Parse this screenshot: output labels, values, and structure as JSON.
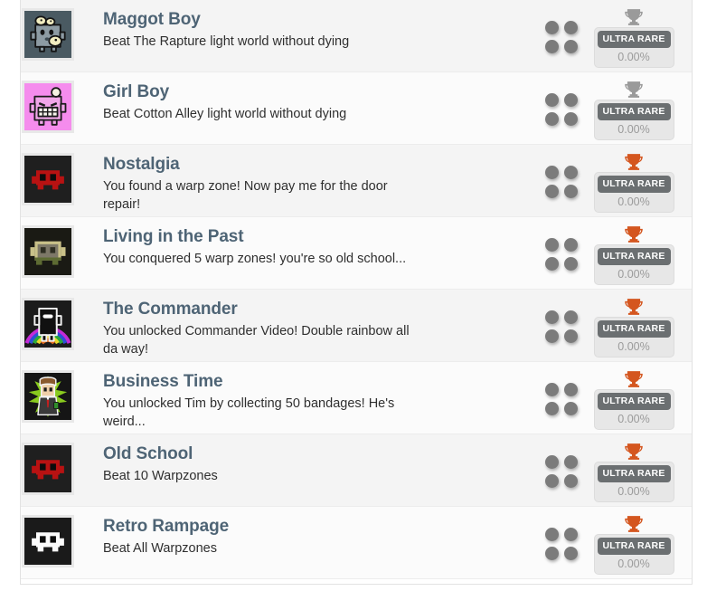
{
  "panel": {
    "name": "achievement-list"
  },
  "icons": {
    "dot_grid": "dot-grid-icon",
    "trophy": "trophy-icon"
  },
  "rarity": {
    "label": "ULTRA RARE",
    "percent": "0.00%",
    "badge_color": "#6b6f71",
    "box_color": "#e7e7e7",
    "trophy_silver": "#9a9a9a",
    "trophy_bronze": "#d4561f"
  },
  "colors": {
    "title": "#4e6475",
    "description": "#2f2f2f",
    "row_bg_a": "#fbfbfb",
    "row_bg_b": "#f4f4f4",
    "border": "#ececec"
  },
  "achievements": [
    {
      "title": "Maggot Boy",
      "description": "Beat The Rapture light world without dying",
      "icon_name": "maggot-boy-avatar",
      "icon_bg": "#4a5a62",
      "trophy_tier": "silver",
      "rarity_label": "ULTRA RARE",
      "percent": "0.00%"
    },
    {
      "title": "Girl Boy",
      "description": "Beat Cotton Alley light world without dying",
      "icon_name": "girl-boy-avatar",
      "icon_bg": "#f58ced",
      "trophy_tier": "silver",
      "rarity_label": "ULTRA RARE",
      "percent": "0.00%"
    },
    {
      "title": "Nostalgia",
      "description": "You found a warp zone! Now pay me for the door repair!",
      "icon_name": "red-meat-boy-avatar",
      "icon_bg": "#1f1f1f",
      "trophy_tier": "bronze",
      "rarity_label": "ULTRA RARE",
      "percent": "0.00%"
    },
    {
      "title": "Living in the Past",
      "description": "You conquered 5 warp zones! you're so old school...",
      "icon_name": "olive-meat-boy-avatar",
      "icon_bg": "#1a1a14",
      "trophy_tier": "bronze",
      "rarity_label": "ULTRA RARE",
      "percent": "0.00%"
    },
    {
      "title": "The Commander",
      "description": "You unlocked Commander Video! Double rainbow all da way!",
      "icon_name": "commander-video-avatar",
      "icon_bg": "#1b1b1b",
      "trophy_tier": "bronze",
      "rarity_label": "ULTRA RARE",
      "percent": "0.00%"
    },
    {
      "title": "Business Time",
      "description": "You unlocked Tim by collecting 50 bandages! He's weird...",
      "icon_name": "tim-avatar",
      "icon_bg": "#151515",
      "trophy_tier": "bronze",
      "rarity_label": "ULTRA RARE",
      "percent": "0.00%"
    },
    {
      "title": "Old School",
      "description": "Beat 10 Warpzones",
      "icon_name": "red-meat-boy-avatar",
      "icon_bg": "#1f1f1f",
      "trophy_tier": "bronze",
      "rarity_label": "ULTRA RARE",
      "percent": "0.00%"
    },
    {
      "title": "Retro Rampage",
      "description": "Beat All Warpzones",
      "icon_name": "white-meat-boy-avatar",
      "icon_bg": "#1a1a1a",
      "trophy_tier": "bronze",
      "rarity_label": "ULTRA RARE",
      "percent": "0.00%"
    }
  ]
}
